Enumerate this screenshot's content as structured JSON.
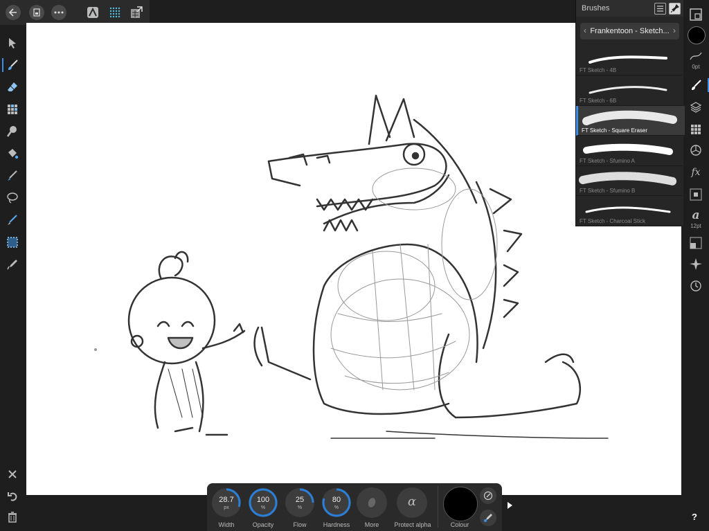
{
  "brushes_panel": {
    "title": "Brushes",
    "category": "Frankentoon - Sketch...",
    "items": [
      {
        "name": "FT Sketch - 4B"
      },
      {
        "name": "FT Sketch - 6B"
      },
      {
        "name": "FT Sketch - Square Eraser"
      },
      {
        "name": "FT Sketch - Sfumino A"
      },
      {
        "name": "FT Sketch - Sfumino B"
      },
      {
        "name": "FT Sketch - Charcoal Stick"
      }
    ],
    "selected_index": 2
  },
  "right_toolbar": {
    "stroke_width_label": "0pt",
    "text_size_label": "12pt",
    "text_glyph": "a",
    "fx_glyph": "fx"
  },
  "context_toolbar": {
    "width": {
      "value": "28.7",
      "unit": "px",
      "label": "Width",
      "fraction": 0.3
    },
    "opacity": {
      "value": "100",
      "unit": "%",
      "label": "Opacity",
      "fraction": 1.0
    },
    "flow": {
      "value": "25",
      "unit": "%",
      "label": "Flow",
      "fraction": 0.25
    },
    "hardness": {
      "value": "80",
      "unit": "%",
      "label": "Hardness",
      "fraction": 0.8
    },
    "more_label": "More",
    "protect_alpha_label": "Protect alpha",
    "protect_alpha_glyph": "α",
    "colour_label": "Colour",
    "colour_value": "#000000"
  },
  "help_label": "?",
  "colors": {
    "accent": "#3d8ee8",
    "panel": "#262626",
    "background": "#1e1e1e"
  }
}
